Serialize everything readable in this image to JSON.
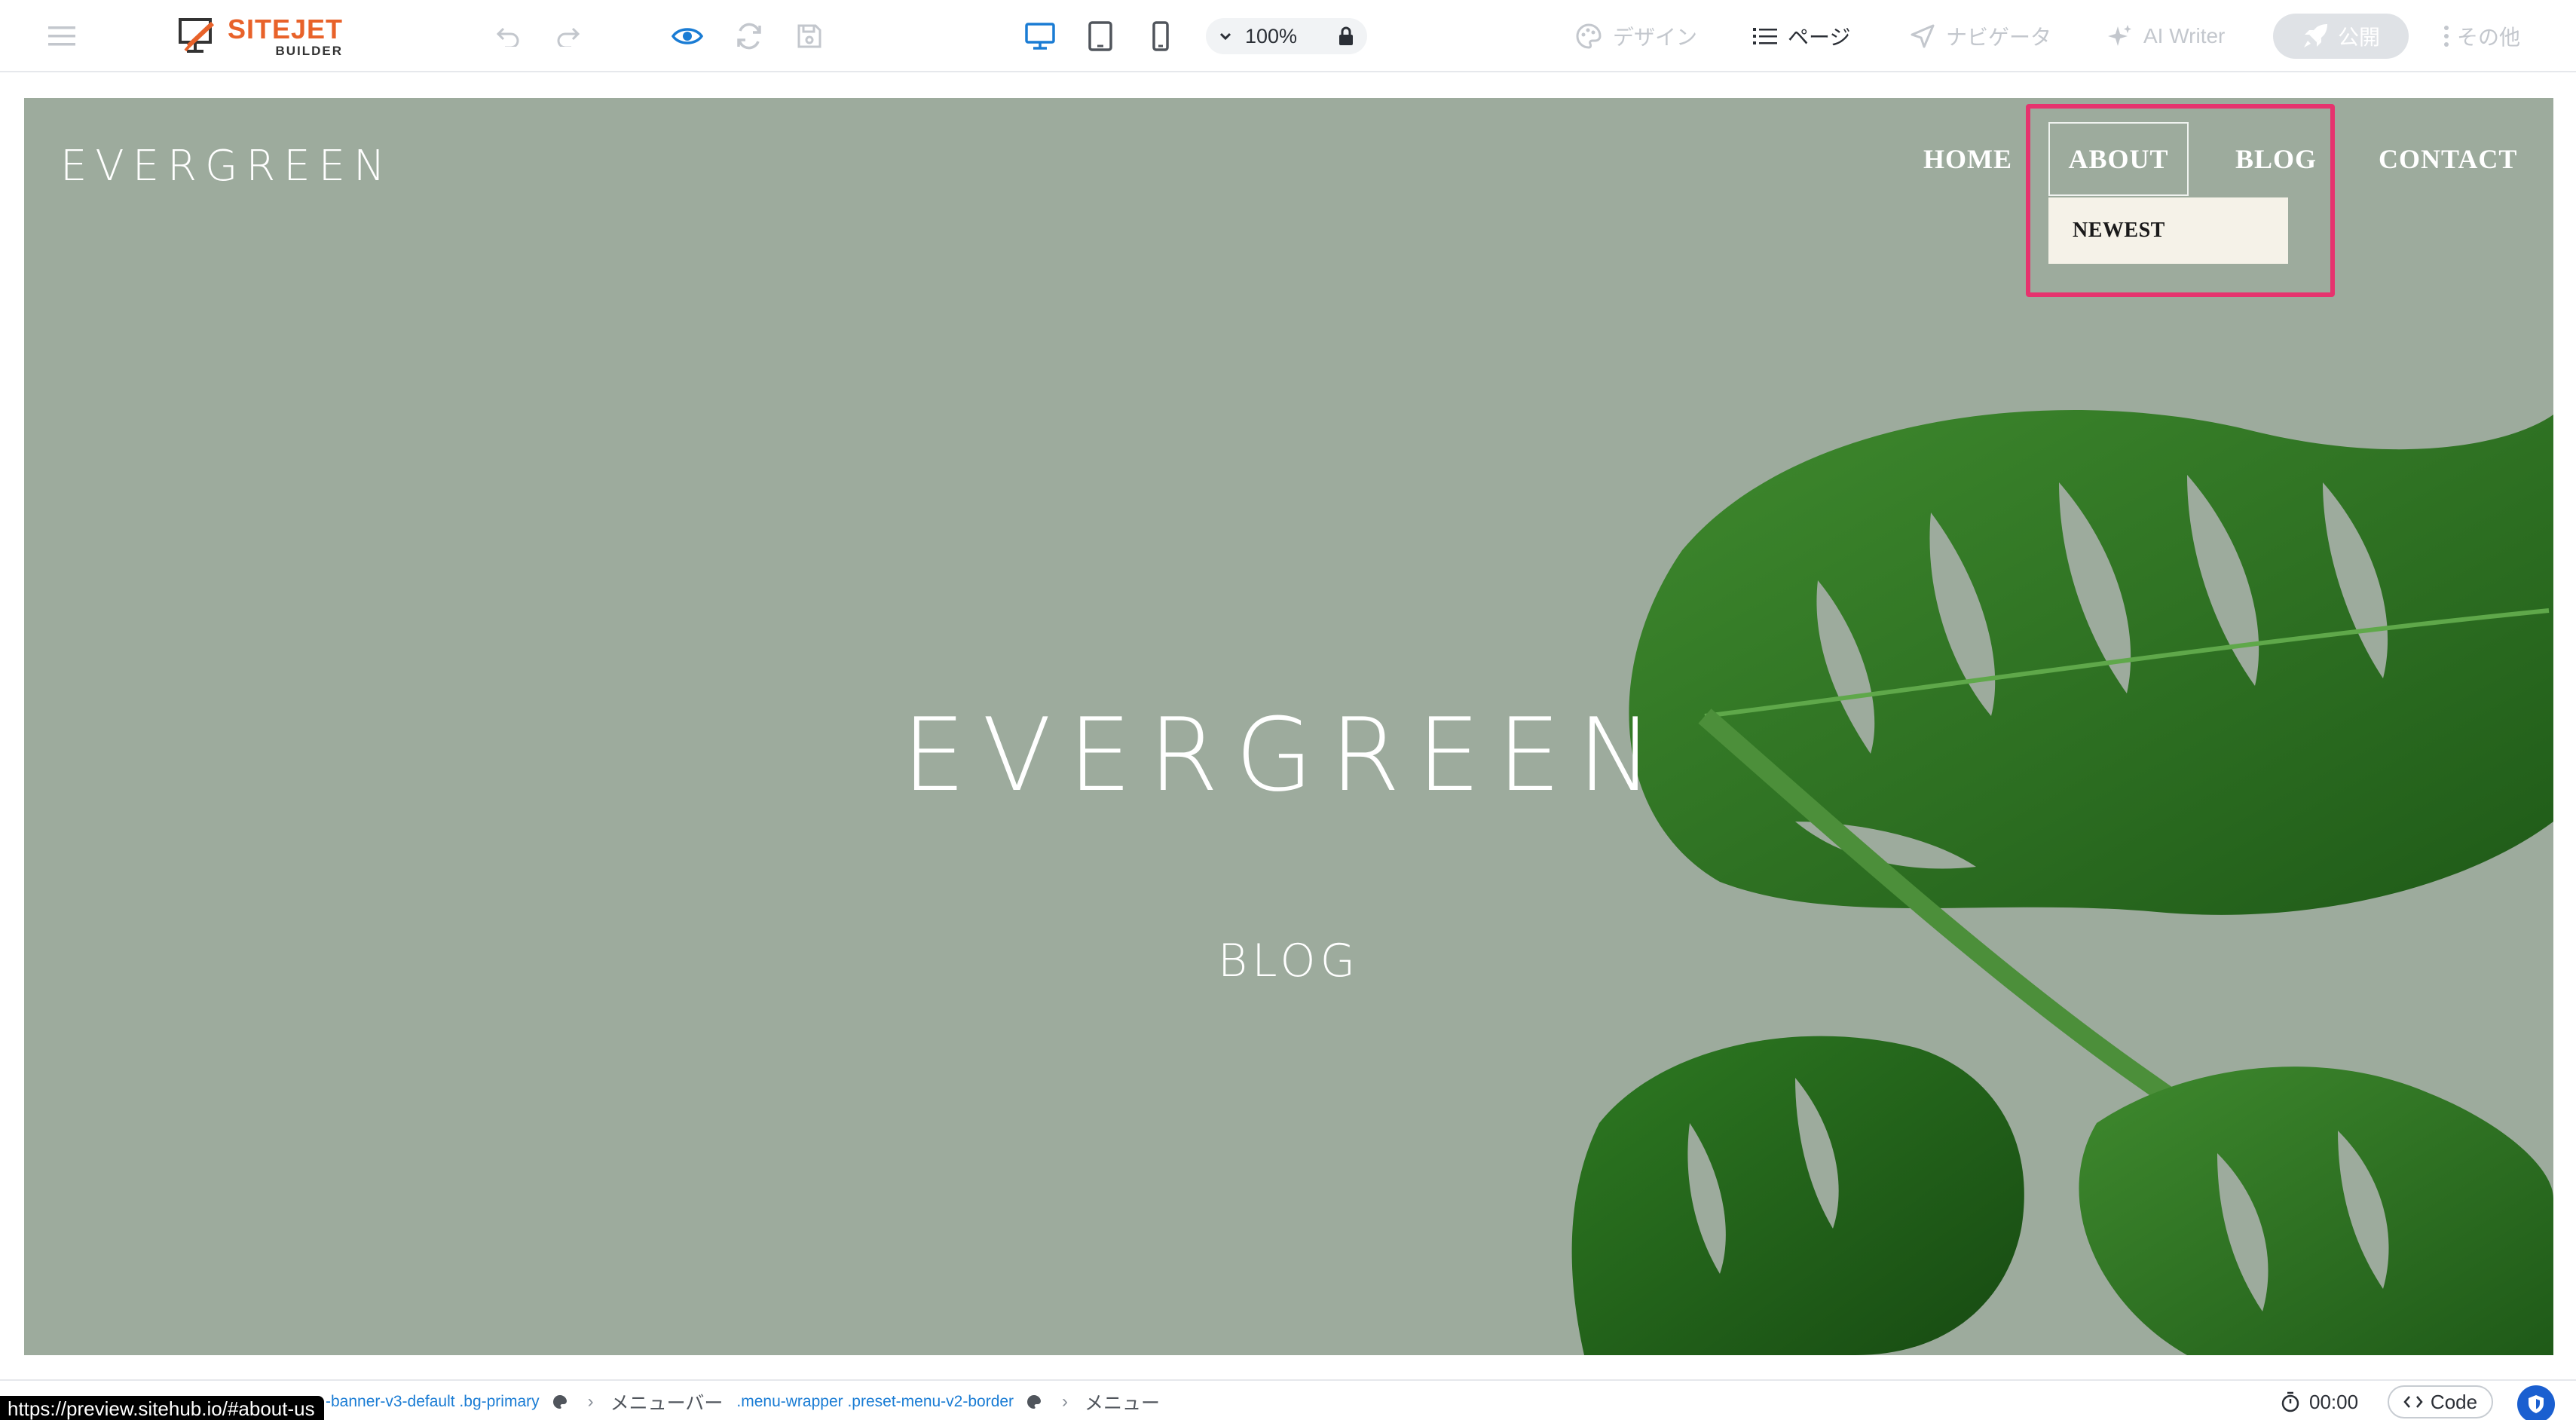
{
  "app": {
    "logo_main": "SITEJET",
    "logo_sub": "BUILDER"
  },
  "toolbar": {
    "zoom": "100%",
    "design_label": "デザイン",
    "pages_label": "ページ",
    "navigator_label": "ナビゲータ",
    "ai_writer_label": "AI Writer",
    "publish_label": "公開",
    "more_label": "その他"
  },
  "site": {
    "logo": "EVERGREEN",
    "nav": {
      "home": "HOME",
      "about": "ABOUT",
      "blog": "BLOG",
      "contact": "CONTACT"
    },
    "dropdown_item": "NEWEST",
    "hero_title": "EVERGREEN",
    "hero_subtitle": "BLOG"
  },
  "statusbar": {
    "url": "https://preview.sitehub.io/#about-us",
    "crumb1_class": "-banner-v3-default .bg-primary",
    "crumb2_label": "メニューバー",
    "crumb2_class": ".menu-wrapper .preset-menu-v2-border",
    "crumb3_label": "メニュー",
    "timer": "00:00",
    "code_label": "Code"
  },
  "colors": {
    "brand": "#e8622a",
    "accent_blue": "#1a7cd4",
    "hero_bg": "#9dab9d",
    "highlight": "#e6336e",
    "dropdown_bg": "#f5f2e8"
  }
}
